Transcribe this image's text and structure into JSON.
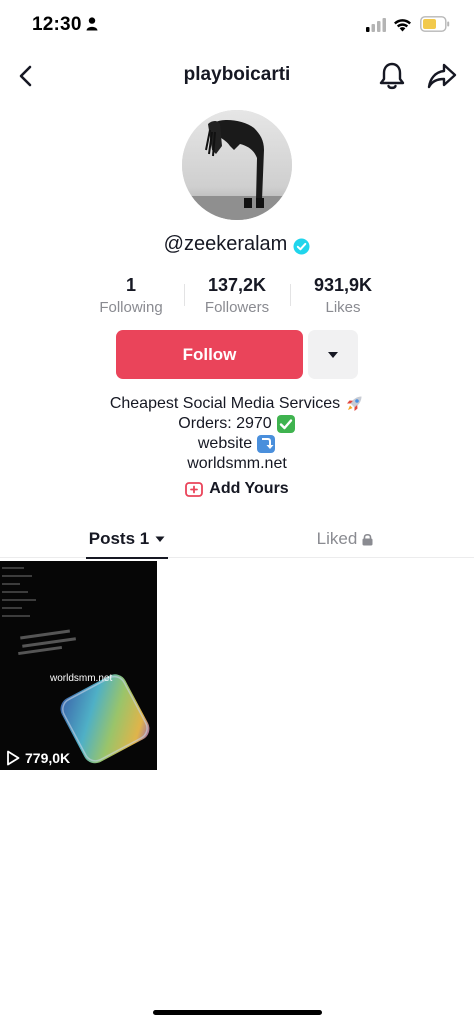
{
  "status_bar": {
    "time": "12:30"
  },
  "header": {
    "title": "playboicarti"
  },
  "profile": {
    "username": "@zeekeralam",
    "verified": true
  },
  "stats": [
    {
      "value": "1",
      "label": "Following"
    },
    {
      "value": "137,2K",
      "label": "Followers"
    },
    {
      "value": "931,9K",
      "label": "Likes"
    }
  ],
  "actions": {
    "follow_label": "Follow"
  },
  "bio": {
    "line1": "Cheapest Social Media Services",
    "line2": "Orders: 2970",
    "line3": "website",
    "line4": "worldsmm.net"
  },
  "add_yours": {
    "label": "Add Yours"
  },
  "tabs": {
    "posts_label": "Posts 1",
    "liked_label": "Liked"
  },
  "posts": [
    {
      "caption": "worldsmm.net",
      "views": "779,0K"
    }
  ],
  "colors": {
    "follow_button": "#ea445a",
    "verified_badge": "#20d5ec",
    "text_primary": "#161823",
    "text_secondary": "#8a8b91"
  },
  "icons": {
    "back": "chevron-left-icon",
    "bell": "bell-icon",
    "share": "share-arrow-icon",
    "dropdown": "caret-down-icon",
    "lock": "lock-icon",
    "play": "play-icon"
  }
}
